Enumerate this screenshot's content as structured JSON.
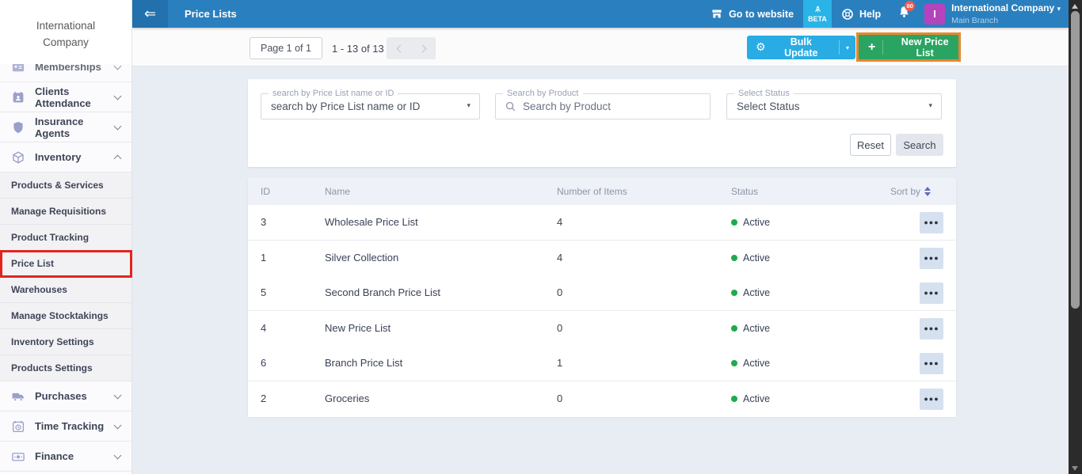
{
  "colors": {
    "header_blue": "#2A80BF",
    "beta_cyan": "#29B3E6",
    "bulk_update_cyan": "#29ACE3",
    "new_price_green": "#2AA462",
    "annotation_orange": "#E8882F",
    "annotation_red": "#E1261D",
    "active_green": "#1FA94F",
    "avatar_purple": "#B544BC"
  },
  "sidebar": {
    "logo_line1": "International",
    "logo_line2": "Company",
    "items": [
      {
        "label": "Memberships"
      },
      {
        "label": "Clients Attendance"
      },
      {
        "label": "Insurance Agents"
      },
      {
        "label": "Inventory"
      },
      {
        "label": "Purchases"
      },
      {
        "label": "Time Tracking"
      },
      {
        "label": "Finance"
      }
    ],
    "inventory_children": [
      "Products & Services",
      "Manage Requisitions",
      "Product Tracking",
      "Price List",
      "Warehouses",
      "Manage Stocktakings",
      "Inventory Settings",
      "Products Settings"
    ]
  },
  "header": {
    "title": "Price Lists",
    "go_to_website": "Go to website",
    "beta": "BETA",
    "help": "Help",
    "notifications_count": "80",
    "company_name": "International Company",
    "branch": "Main Branch",
    "avatar_initial": "I"
  },
  "toolbar": {
    "page_indicator": "Page 1 of 1",
    "range_indicator": "1 - 13 of 13",
    "bulk_update_label": "Bulk Update",
    "new_price_list_label": "New Price List"
  },
  "filters": {
    "price_list_legend": "search by Price List name or ID",
    "price_list_value": "search by Price List name or ID",
    "product_legend": "Search by Product",
    "product_placeholder": "Search by Product",
    "status_legend": "Select Status",
    "status_value": "Select Status",
    "reset_label": "Reset",
    "search_label": "Search"
  },
  "table": {
    "columns": [
      "ID",
      "Name",
      "Number of Items",
      "Status",
      "Sort by"
    ],
    "rows": [
      {
        "id": "3",
        "name": "Wholesale Price List",
        "items": "4",
        "status": "Active"
      },
      {
        "id": "1",
        "name": "Silver Collection",
        "items": "4",
        "status": "Active"
      },
      {
        "id": "5",
        "name": "Second Branch Price List",
        "items": "0",
        "status": "Active"
      },
      {
        "id": "4",
        "name": "New Price List",
        "items": "0",
        "status": "Active"
      },
      {
        "id": "6",
        "name": "Branch Price List",
        "items": "1",
        "status": "Active"
      },
      {
        "id": "2",
        "name": "Groceries",
        "items": "0",
        "status": "Active"
      }
    ]
  }
}
